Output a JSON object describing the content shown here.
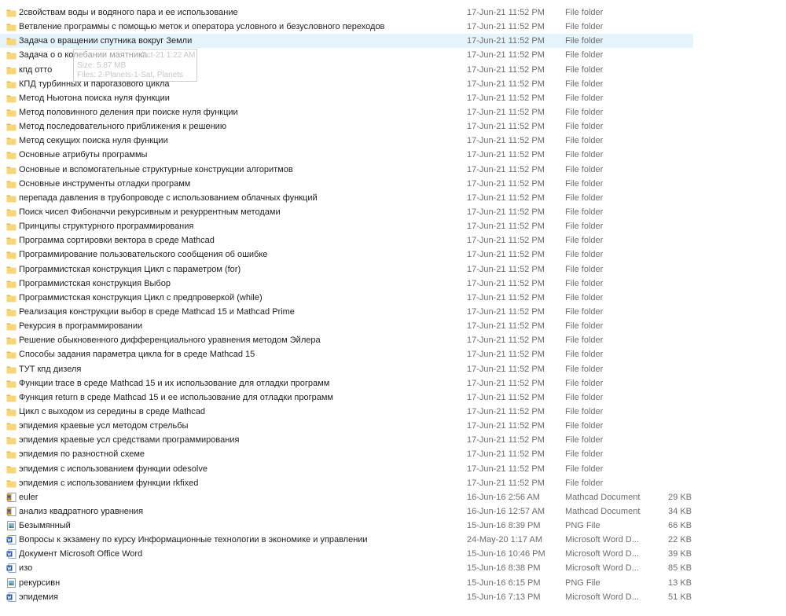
{
  "colors": {
    "folder": "#f6d676",
    "folder_dark": "#e3b647",
    "word": "#2b5797",
    "selection": "#e5f3fb"
  },
  "rows": [
    {
      "name": "2свойствам воды и водяного пара и ее использование",
      "date": "17-Jun-21 11:52 PM",
      "type": "File folder",
      "size": "",
      "icon": "folder-icon"
    },
    {
      "name": "Ветвление программы с помощью меток и оператора условного и безусловного переходов",
      "date": "17-Jun-21 11:52 PM",
      "type": "File folder",
      "size": "",
      "icon": "folder-icon"
    },
    {
      "name": "Задача о вращении спутника вокруг Земли",
      "date": "17-Jun-21 11:52 PM",
      "type": "File folder",
      "size": "",
      "icon": "folder-icon",
      "selected": true
    },
    {
      "name": "Задача о о колебании маятника",
      "date": "17-Jun-21 11:52 PM",
      "type": "File folder",
      "size": "",
      "icon": "folder-icon"
    },
    {
      "name": "кпд отто",
      "date": "17-Jun-21 11:52 PM",
      "type": "File folder",
      "size": "",
      "icon": "folder-icon"
    },
    {
      "name": "КПД турбинных и парогазового цикла",
      "date": "17-Jun-21 11:52 PM",
      "type": "File folder",
      "size": "",
      "icon": "folder-icon"
    },
    {
      "name": "Метод Ньютона поиска нуля функции",
      "date": "17-Jun-21 11:52 PM",
      "type": "File folder",
      "size": "",
      "icon": "folder-icon"
    },
    {
      "name": "Метод половинного деления при поиске нуля функции",
      "date": "17-Jun-21 11:52 PM",
      "type": "File folder",
      "size": "",
      "icon": "folder-icon"
    },
    {
      "name": "Метод последовательного приближения к решению",
      "date": "17-Jun-21 11:52 PM",
      "type": "File folder",
      "size": "",
      "icon": "folder-icon"
    },
    {
      "name": "Метод секущих поиска нуля функции",
      "date": "17-Jun-21 11:52 PM",
      "type": "File folder",
      "size": "",
      "icon": "folder-icon"
    },
    {
      "name": "Основные атрибуты программы",
      "date": "17-Jun-21 11:52 PM",
      "type": "File folder",
      "size": "",
      "icon": "folder-icon"
    },
    {
      "name": "Основные и вспомогательные структурные конструкции алгоритмов",
      "date": "17-Jun-21 11:52 PM",
      "type": "File folder",
      "size": "",
      "icon": "folder-icon"
    },
    {
      "name": "Основные инструменты отладки программ",
      "date": "17-Jun-21 11:52 PM",
      "type": "File folder",
      "size": "",
      "icon": "folder-icon"
    },
    {
      "name": "перепада давления в трубопроводе с использованием облачных функций",
      "date": "17-Jun-21 11:52 PM",
      "type": "File folder",
      "size": "",
      "icon": "folder-icon"
    },
    {
      "name": "Поиск чисел Фибоначчи рекурсивным и рекуррентным методами",
      "date": "17-Jun-21 11:52 PM",
      "type": "File folder",
      "size": "",
      "icon": "folder-icon"
    },
    {
      "name": "Принципы структурного программирования",
      "date": "17-Jun-21 11:52 PM",
      "type": "File folder",
      "size": "",
      "icon": "folder-icon"
    },
    {
      "name": "Программа сортировки вектора в среде Mathcad",
      "date": "17-Jun-21 11:52 PM",
      "type": "File folder",
      "size": "",
      "icon": "folder-icon"
    },
    {
      "name": "Программирование пользовательского сообщения об ошибке",
      "date": "17-Jun-21 11:52 PM",
      "type": "File folder",
      "size": "",
      "icon": "folder-icon"
    },
    {
      "name": "Программистская  конструкция Цикл с параметром (for)",
      "date": "17-Jun-21 11:52 PM",
      "type": "File folder",
      "size": "",
      "icon": "folder-icon"
    },
    {
      "name": "Программистская конструкция Выбор",
      "date": "17-Jun-21 11:52 PM",
      "type": "File folder",
      "size": "",
      "icon": "folder-icon"
    },
    {
      "name": "Программистская конструкция Цикл с предпроверкой (while)",
      "date": "17-Jun-21 11:52 PM",
      "type": "File folder",
      "size": "",
      "icon": "folder-icon"
    },
    {
      "name": "Реализация конструкции выбор в среде Mathcad 15 и Mathcad Prime",
      "date": "17-Jun-21 11:52 PM",
      "type": "File folder",
      "size": "",
      "icon": "folder-icon"
    },
    {
      "name": "Рекурсия в программировании",
      "date": "17-Jun-21 11:52 PM",
      "type": "File folder",
      "size": "",
      "icon": "folder-icon"
    },
    {
      "name": "Решение обыкновенного дифференциального уравнения методом Эйлера",
      "date": "17-Jun-21 11:52 PM",
      "type": "File folder",
      "size": "",
      "icon": "folder-icon"
    },
    {
      "name": "Способы задания параметра цикла for в среде Mathcad 15",
      "date": "17-Jun-21 11:52 PM",
      "type": "File folder",
      "size": "",
      "icon": "folder-icon"
    },
    {
      "name": "ТУТ кпд дизеля",
      "date": "17-Jun-21 11:52 PM",
      "type": "File folder",
      "size": "",
      "icon": "folder-icon"
    },
    {
      "name": "Функции trace в среде Mathcad 15 и их использование для  отладки программ",
      "date": "17-Jun-21 11:52 PM",
      "type": "File folder",
      "size": "",
      "icon": "folder-icon"
    },
    {
      "name": "Функция return  в среде Mathcad 15 и ее использование для  отладки программ",
      "date": "17-Jun-21 11:52 PM",
      "type": "File folder",
      "size": "",
      "icon": "folder-icon"
    },
    {
      "name": "Цикл с выходом из середины в среде Mathcad",
      "date": "17-Jun-21 11:52 PM",
      "type": "File folder",
      "size": "",
      "icon": "folder-icon"
    },
    {
      "name": "эпидемия краевые усл методом стрельбы",
      "date": "17-Jun-21 11:52 PM",
      "type": "File folder",
      "size": "",
      "icon": "folder-icon"
    },
    {
      "name": "эпидемия краевые усл средствами программирования",
      "date": "17-Jun-21 11:52 PM",
      "type": "File folder",
      "size": "",
      "icon": "folder-icon"
    },
    {
      "name": "эпидемия по разностной схеме",
      "date": "17-Jun-21 11:52 PM",
      "type": "File folder",
      "size": "",
      "icon": "folder-icon"
    },
    {
      "name": "эпидемия с использованием функции odesolve",
      "date": "17-Jun-21 11:52 PM",
      "type": "File folder",
      "size": "",
      "icon": "folder-icon"
    },
    {
      "name": "эпидемия с использованием функции rkfixed",
      "date": "17-Jun-21 11:52 PM",
      "type": "File folder",
      "size": "",
      "icon": "folder-icon"
    },
    {
      "name": "euler",
      "date": "16-Jun-16 2:56 AM",
      "type": "Mathcad Document",
      "size": "29 KB",
      "icon": "mathcad-document-icon"
    },
    {
      "name": "анализ квадратного уравнения",
      "date": "16-Jun-16 12:57 AM",
      "type": "Mathcad Document",
      "size": "34 KB",
      "icon": "mathcad-document-icon"
    },
    {
      "name": "Безымянный",
      "date": "15-Jun-16 8:39 PM",
      "type": "PNG File",
      "size": "66 KB",
      "icon": "png-file-icon"
    },
    {
      "name": "Вопросы к экзамену по курсу Информационные технологии в экономике и управлении",
      "date": "24-May-20 1:17 AM",
      "type": "Microsoft Word D...",
      "size": "22 KB",
      "icon": "word-document-icon"
    },
    {
      "name": "Документ Microsoft Office Word",
      "date": "15-Jun-16 10:46 PM",
      "type": "Microsoft Word D...",
      "size": "39 KB",
      "icon": "word-document-icon"
    },
    {
      "name": "изо",
      "date": "15-Jun-16 8:38 PM",
      "type": "Microsoft Word D...",
      "size": "85 KB",
      "icon": "word-document-icon"
    },
    {
      "name": "рекурсивн",
      "date": "15-Jun-16 6:15 PM",
      "type": "PNG File",
      "size": "13 KB",
      "icon": "png-file-icon"
    },
    {
      "name": "эпидемия",
      "date": "15-Jun-16 7:13 PM",
      "type": "Microsoft Word D...",
      "size": "51 KB",
      "icon": "word-document-icon"
    }
  ],
  "tooltip": {
    "date": "Oct-21 1:22 AM",
    "size": "Size: 5.87 MB",
    "files": "Files: 2-Planets-1-Sat, Planets"
  }
}
